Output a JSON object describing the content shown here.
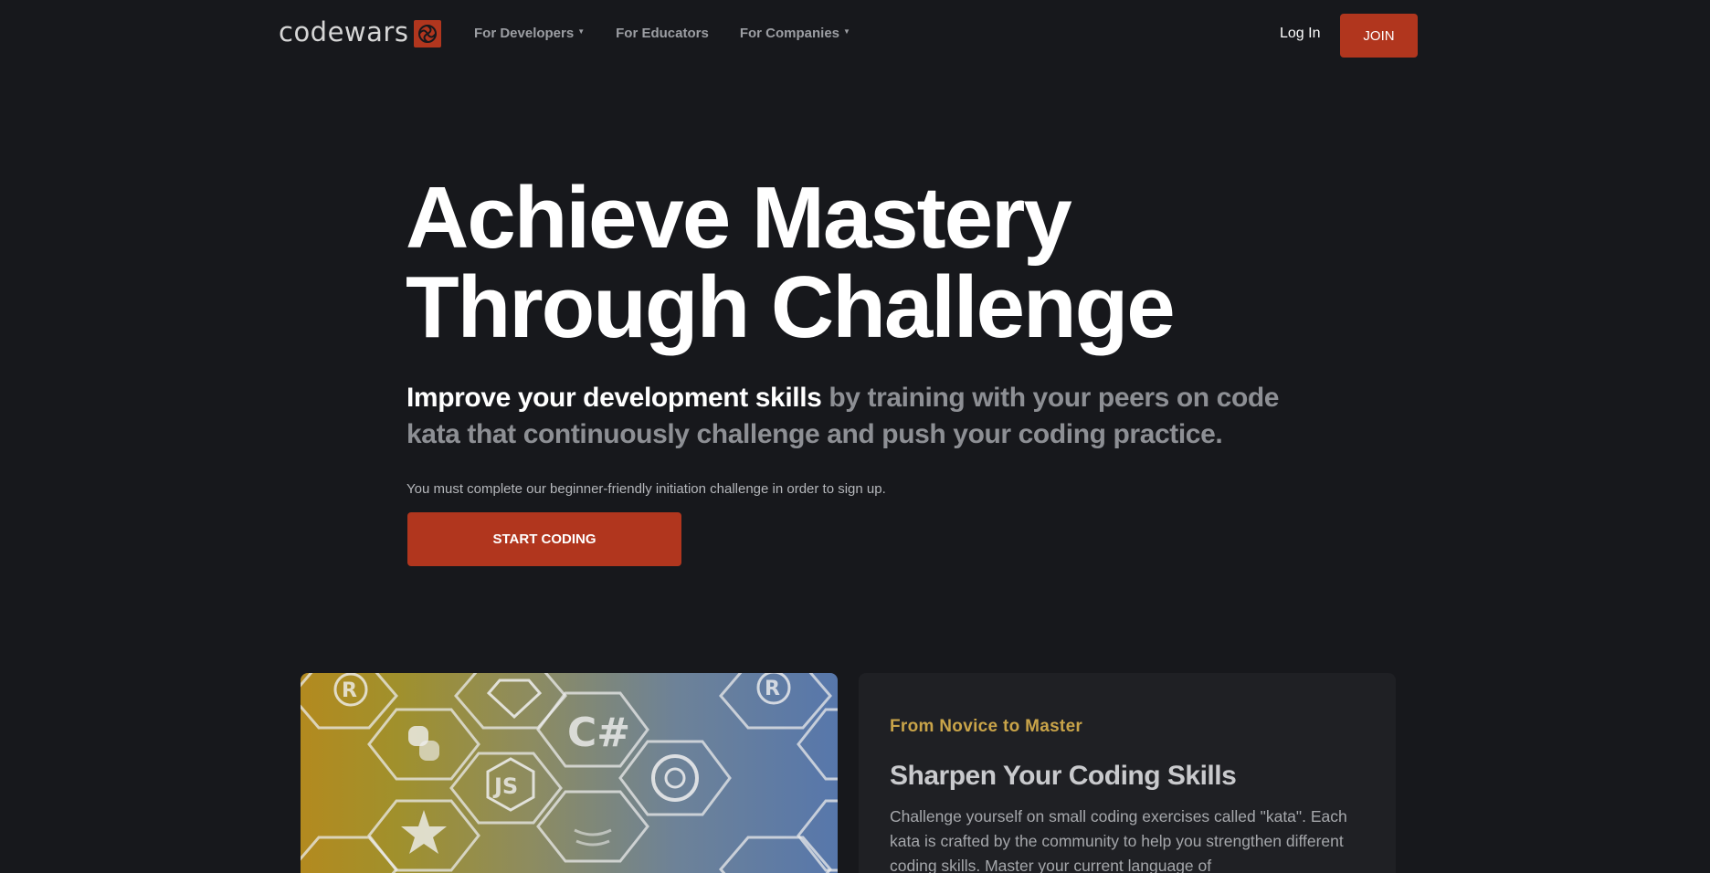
{
  "nav": {
    "logo_text": "codewars",
    "links": [
      {
        "label": "For Developers",
        "dropdown": true
      },
      {
        "label": "For Educators",
        "dropdown": false
      },
      {
        "label": "For Companies",
        "dropdown": true
      }
    ],
    "login_label": "Log In",
    "join_label": "JOIN"
  },
  "hero": {
    "title_line1": "Achieve Mastery",
    "title_line2": "Through Challenge",
    "subtitle_highlight": "Improve your development skills",
    "subtitle_rest": " by training with your peers on code kata that continuously challenge and push your coding practice.",
    "note": "You must complete our beginner-friendly initiation challenge in order to sign up.",
    "cta_label": "START CODING"
  },
  "feature": {
    "eyebrow": "From Novice to Master",
    "title": "Sharpen Your Coding Skills",
    "body": "Challenge yourself on small coding exercises called \"kata\". Each kata is crafted by the community to help you strengthen different coding skills. Master your current language of",
    "language_icons": [
      "rust-icon",
      "ruby-icon",
      "python-icon",
      "csharp-icon",
      "javascript-icon",
      "clojure-icon",
      "elixir-icon",
      "java-icon"
    ]
  },
  "colors": {
    "background": "#17181c",
    "accent": "#b1361e",
    "eyebrow": "#c9a449",
    "card": "#1f2024"
  }
}
